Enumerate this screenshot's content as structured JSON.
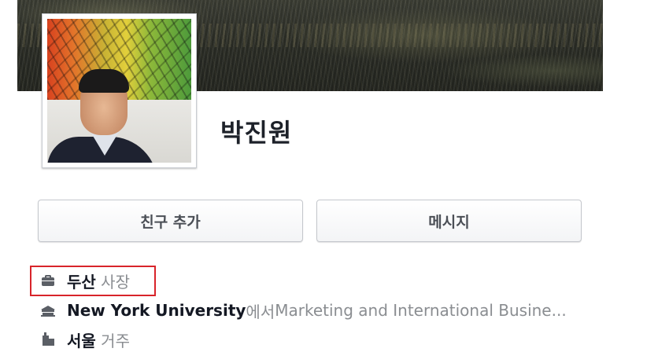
{
  "profile": {
    "name": "박진원"
  },
  "actions": {
    "add_friend_label": "친구 추가",
    "message_label": "메시지"
  },
  "info": {
    "work": {
      "company": "두산",
      "position": "사장",
      "icon": "briefcase-icon"
    },
    "education": {
      "school": "New York University",
      "connector": "에서",
      "field": " Marketing and International Busine...",
      "icon": "school-icon"
    },
    "residence": {
      "city": "서울",
      "label": "거주",
      "icon": "home-icon"
    }
  },
  "colors": {
    "highlight_border": "#d8242a",
    "text_primary": "#141823",
    "text_muted": "#8a8d91",
    "icon": "#5b5f66"
  }
}
